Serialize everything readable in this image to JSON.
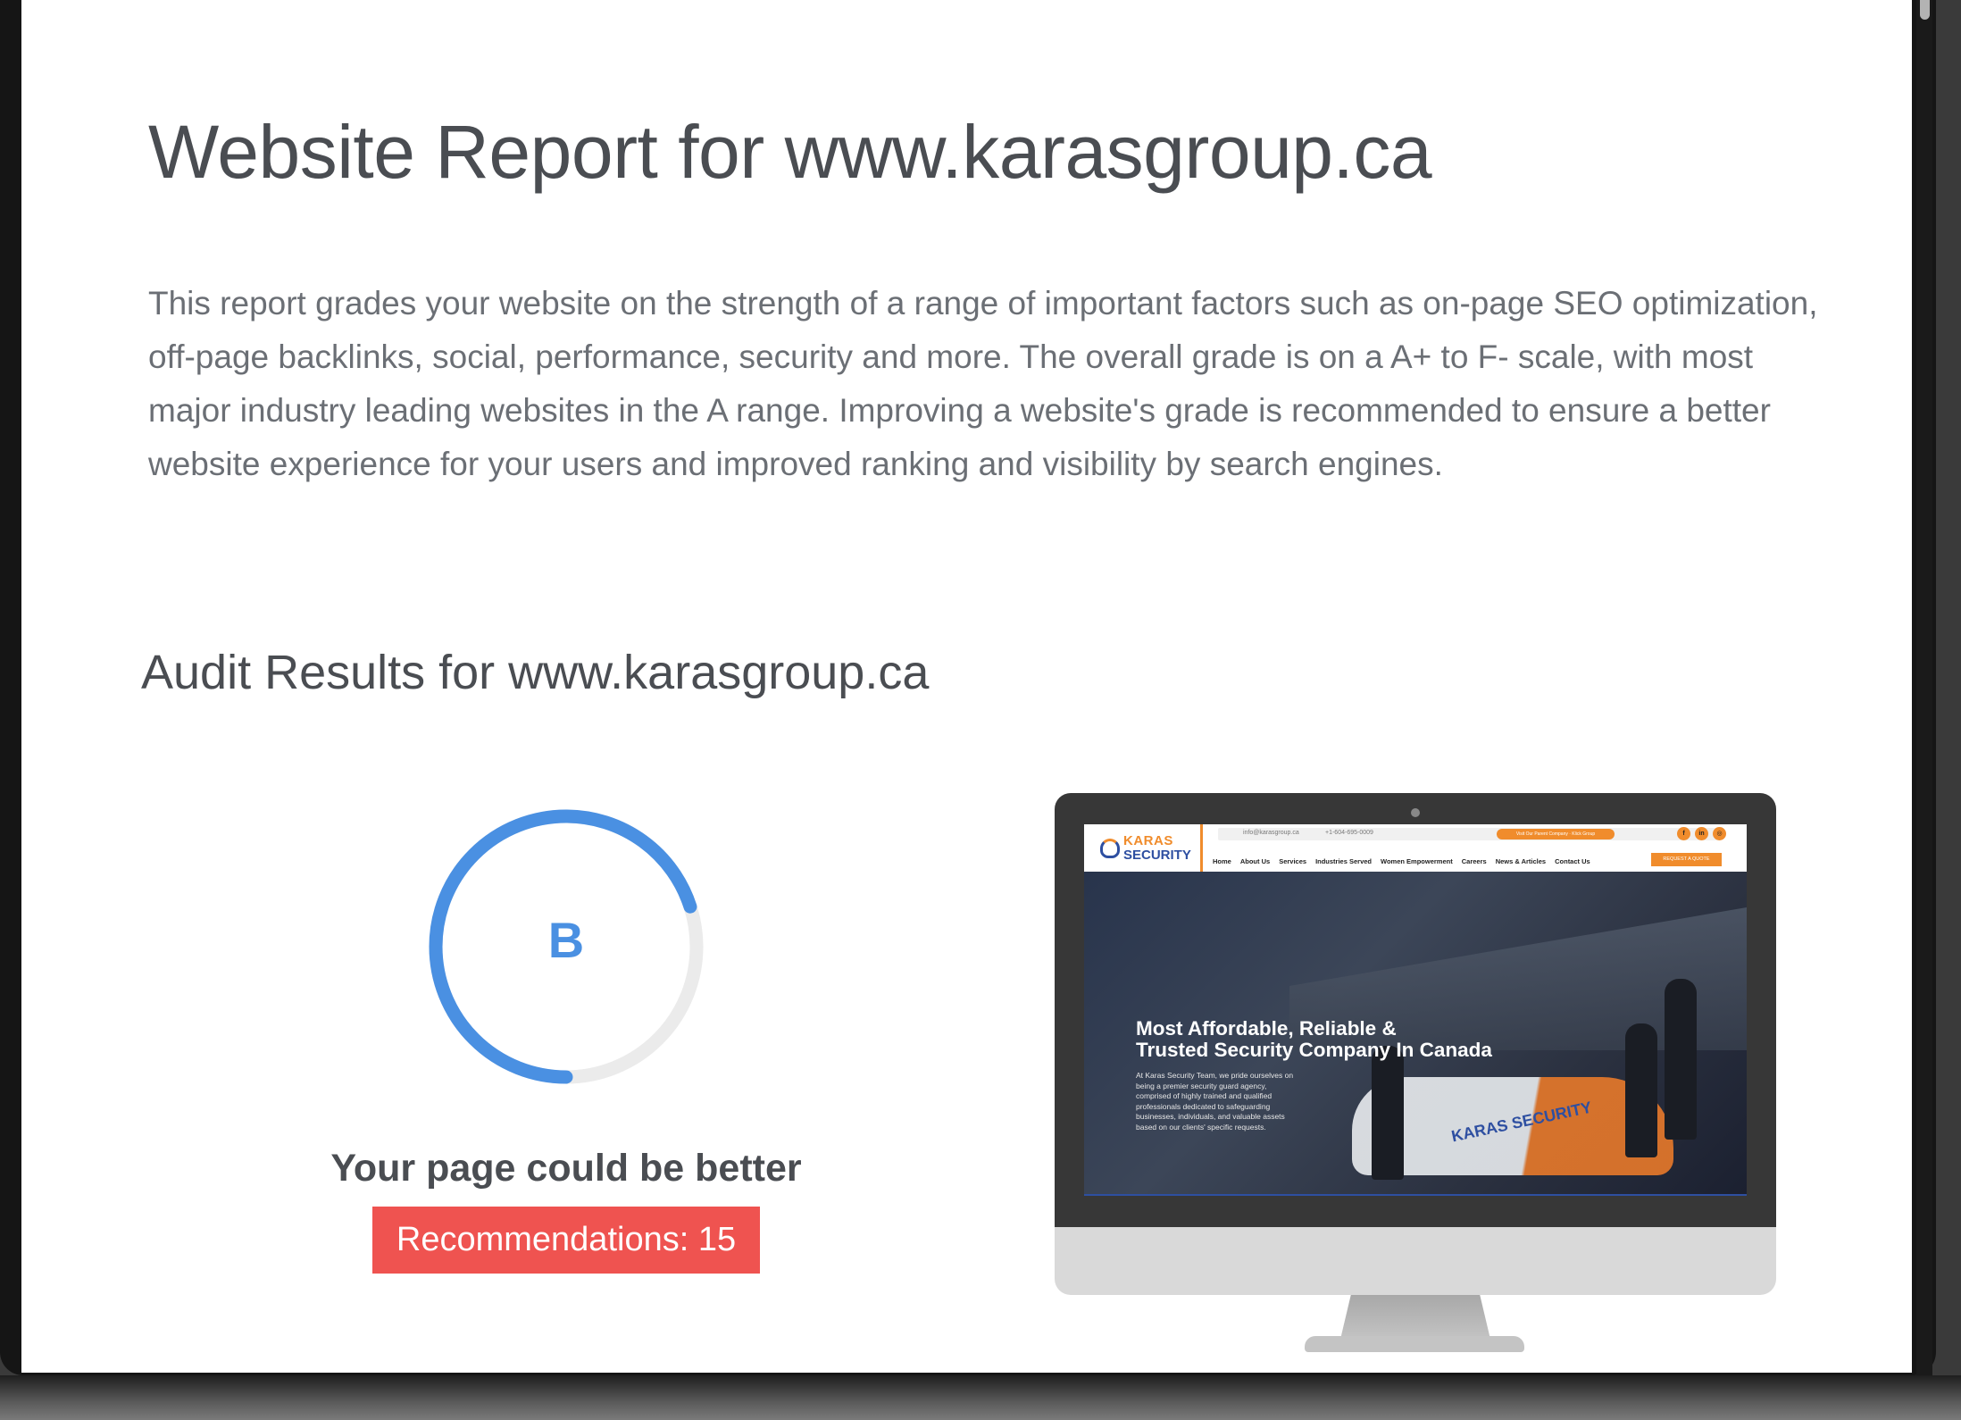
{
  "report": {
    "title": "Website Report for www.karasgroup.ca",
    "intro": "This report grades your website on the strength of a range of important factors such as on-page SEO optimization, off-page backlinks, social, performance, security and more. The overall grade is on a A+ to F- scale, with most major industry leading websites in the A range. Improving a website's grade is recommended to ensure a better website experience for your users and improved ranking and visibility by search engines."
  },
  "audit": {
    "title": "Audit Results for www.karasgroup.ca",
    "grade": "B",
    "grade_progress_percent": 70,
    "grade_color": "#4a90e2",
    "track_color": "#ebebeb",
    "verdict": "Your page could be better",
    "recommendations_label": "Recommendations: 15",
    "badge_color": "#ef5350"
  },
  "preview": {
    "logo_top": "KARAS",
    "logo_bottom": "SECURITY",
    "email": "info@karasgroup.ca",
    "phone": "+1-604-695-0009",
    "parent_pill": "Visit Our Parent Company · Klick Group",
    "social_icons": [
      "f",
      "in",
      "◎"
    ],
    "nav": [
      "Home",
      "About Us",
      "Services",
      "Industries Served",
      "Women Empowerment",
      "Careers",
      "News & Articles",
      "Contact Us"
    ],
    "cta": "REQUEST A QUOTE",
    "hero_title_line1": "Most Affordable, Reliable &",
    "hero_title_line2": "Trusted Security Company In Canada",
    "hero_body": "At Karas Security Team, we pride ourselves on being a premier security guard agency, comprised of highly trained and qualified professionals dedicated to safeguarding businesses, individuals, and valuable assets based on our clients' specific requests.",
    "car_text": "KARAS SECURITY",
    "accent": "#f08c2c",
    "brand_blue": "#2e4fa1"
  }
}
